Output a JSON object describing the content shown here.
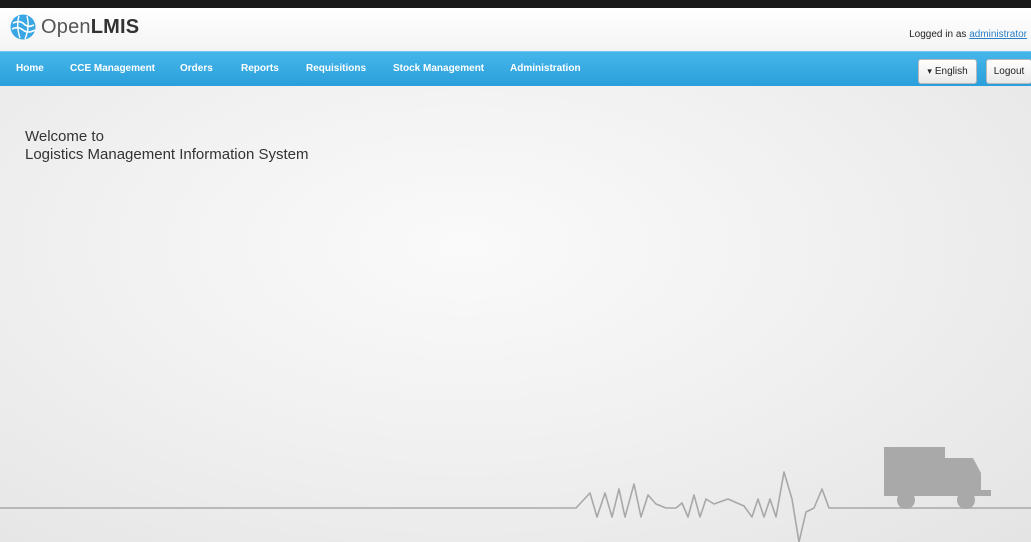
{
  "app": {
    "logo_prefix": "Open",
    "logo_suffix": "LMIS"
  },
  "header": {
    "logged_in_prefix": "Logged in as",
    "username": "administrator"
  },
  "nav": {
    "items": [
      {
        "label": "Home"
      },
      {
        "label": "CCE Management"
      },
      {
        "label": "Orders"
      },
      {
        "label": "Reports"
      },
      {
        "label": "Requisitions"
      },
      {
        "label": "Stock Management"
      },
      {
        "label": "Administration"
      }
    ],
    "language_button": "English",
    "language_caret": "▾",
    "logout_button": "Logout"
  },
  "main": {
    "welcome_line1": "Welcome to",
    "welcome_line2": "Logistics Management Information System"
  },
  "colors": {
    "nav_bar": "#2a9fdb",
    "link": "#2a7fc9",
    "decor_line": "#a8a8a8"
  }
}
